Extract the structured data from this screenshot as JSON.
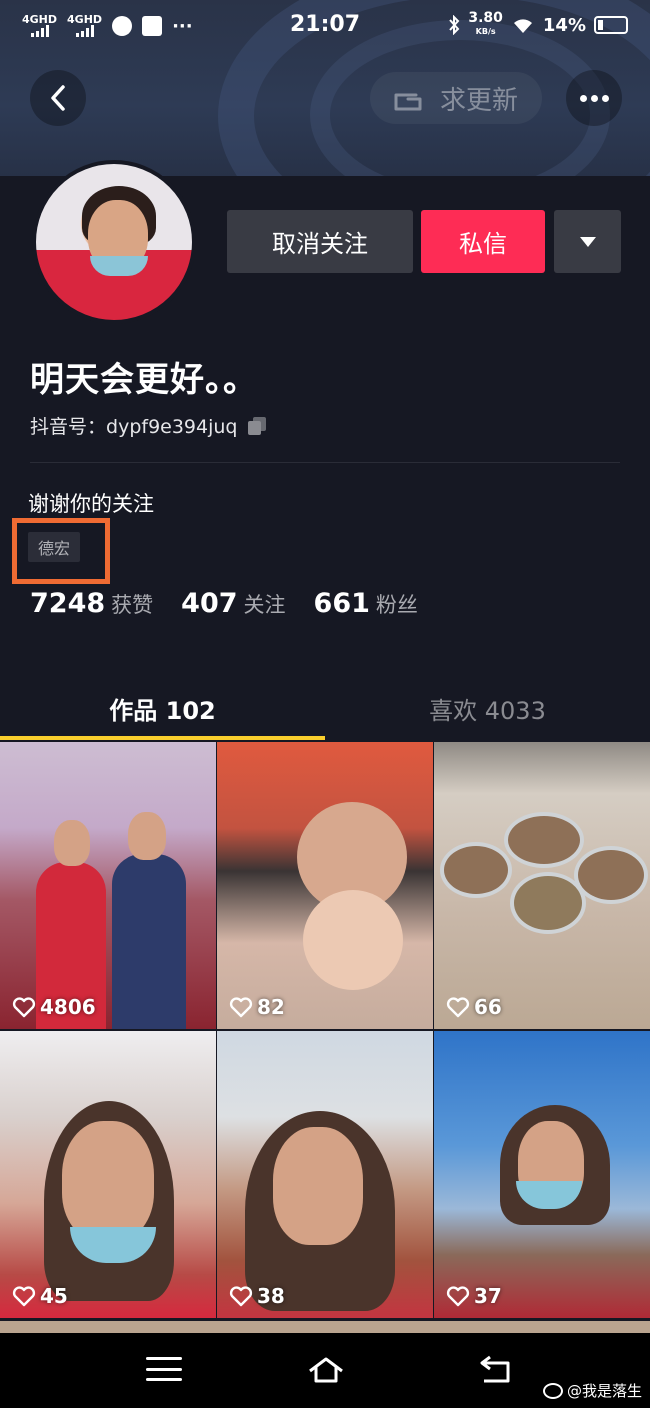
{
  "status_bar": {
    "signal_1": "4GHD",
    "signal_2": "4GHD",
    "time": "21:07",
    "net_speed": "3.80",
    "net_speed_unit": "KB/s",
    "battery": "14%"
  },
  "header": {
    "update_label": "求更新"
  },
  "profile": {
    "unfollow_label": "取消关注",
    "message_label": "私信",
    "name": "明天会更好。。",
    "douyin_id_label": "抖音号：",
    "douyin_id": "dypf9e394juq",
    "bio": "谢谢你的关注",
    "location_tag": "德宏",
    "stats": {
      "likes_value": "7248",
      "likes_label": "获赞",
      "following_value": "407",
      "following_label": "关注",
      "followers_value": "661",
      "followers_label": "粉丝"
    }
  },
  "tabs": {
    "works_label": "作品 102",
    "liked_label": "喜欢 4033"
  },
  "videos": [
    {
      "likes": "4806"
    },
    {
      "likes": "82"
    },
    {
      "likes": "66"
    },
    {
      "likes": "45"
    },
    {
      "likes": "38"
    },
    {
      "likes": "37"
    }
  ],
  "watermark": "@我是落生",
  "colors": {
    "background": "#161823",
    "accent_pink": "#fe2c55",
    "tab_indicator": "#facf2d",
    "highlight_box": "#ef6b33"
  },
  "icons": {
    "back": "chevron-left-icon",
    "more": "more-dots-icon",
    "update": "hand-pointer-icon",
    "dropdown": "triangle-down-icon",
    "copy": "copy-icon",
    "heart": "heart-outline-icon"
  }
}
